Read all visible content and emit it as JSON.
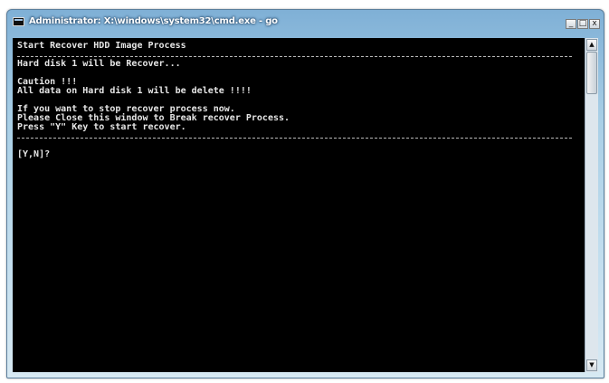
{
  "window": {
    "title": "Administrator: X:\\windows\\system32\\cmd.exe - go",
    "controls": {
      "minimize": "_",
      "maximize": "□",
      "close": "x"
    }
  },
  "console": {
    "lines": [
      "Start Recover HDD Image Process",
      "Hard disk 1 will be Recover...",
      "Caution !!!",
      "All data on Hard disk 1 will be delete !!!!",
      "If you want to stop recover process now.",
      "Please Close this window to Break recover Process.",
      "Press \"Y\" Key to start recover.",
      "[Y,N]?"
    ]
  },
  "scrollbar": {
    "up_glyph": "▲",
    "down_glyph": "▼"
  },
  "icons": {
    "app": "cmd-icon",
    "scroll_up": "arrow-up-icon",
    "scroll_down": "arrow-down-icon"
  }
}
